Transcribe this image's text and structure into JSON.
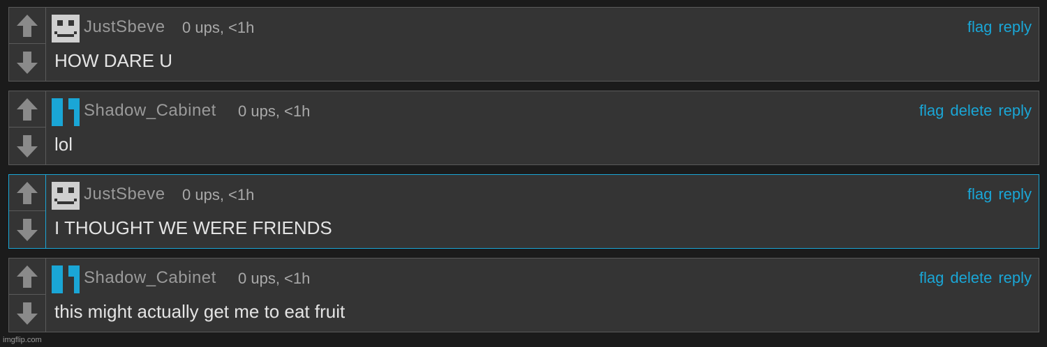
{
  "colors": {
    "background": "#1b1b1b",
    "card": "#343434",
    "border": "#5a5a5a",
    "accent": "#1aa6d6",
    "username": "#9a9a9a",
    "text": "#e4e4e4"
  },
  "comments": [
    {
      "username": "JustSbeve",
      "meta": "0 ups, <1h",
      "text": "HOW DARE U",
      "avatar": "gray-pixel-face-avatar",
      "actions": [
        "flag",
        "reply"
      ]
    },
    {
      "username": "Shadow_Cabinet",
      "meta": "0 ups, <1h",
      "text": "lol",
      "avatar": "blue-quote-avatar",
      "actions": [
        "flag",
        "delete",
        "reply"
      ]
    },
    {
      "username": "JustSbeve",
      "meta": "0 ups, <1h",
      "text": "I THOUGHT WE WERE FRIENDS",
      "avatar": "gray-pixel-face-avatar",
      "actions": [
        "flag",
        "reply"
      ]
    },
    {
      "username": "Shadow_Cabinet",
      "meta": "0 ups, <1h",
      "text": "this might actually get me to eat fruit",
      "avatar": "blue-quote-avatar",
      "actions": [
        "flag",
        "delete",
        "reply"
      ]
    }
  ],
  "icons": {
    "upvote": "arrow-up-icon",
    "downvote": "arrow-down-icon"
  },
  "watermark": "imgflip.com"
}
